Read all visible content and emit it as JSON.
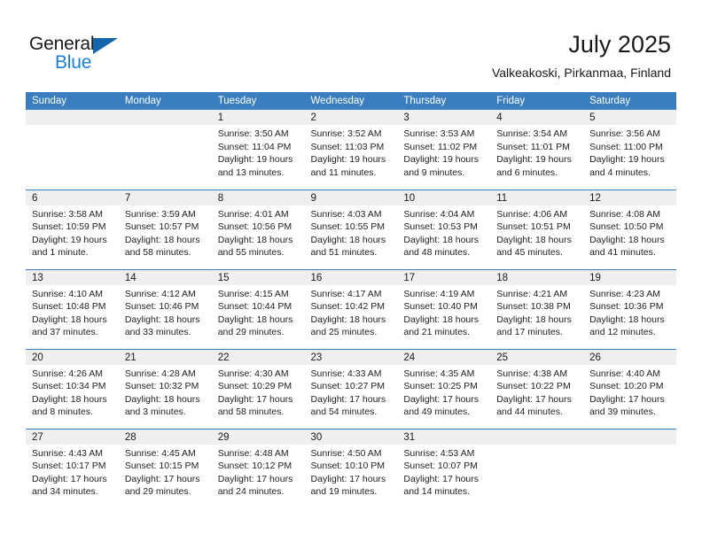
{
  "brand": {
    "name_part1": "General",
    "name_part2": "Blue",
    "triangle_color": "#1565ad",
    "blue_color": "#1a7fd4"
  },
  "header": {
    "title": "July 2025",
    "subtitle": "Valkeakoski, Pirkanmaa, Finland"
  },
  "theme": {
    "header_bg": "#3a7ec0",
    "daynum_bg": "#efefef",
    "text": "#1a1a1a"
  },
  "weekdays": [
    "Sunday",
    "Monday",
    "Tuesday",
    "Wednesday",
    "Thursday",
    "Friday",
    "Saturday"
  ],
  "weeks": [
    [
      {
        "day": ""
      },
      {
        "day": ""
      },
      {
        "day": "1",
        "sunrise": "Sunrise: 3:50 AM",
        "sunset": "Sunset: 11:04 PM",
        "daylight_1": "Daylight: 19 hours",
        "daylight_2": "and 13 minutes."
      },
      {
        "day": "2",
        "sunrise": "Sunrise: 3:52 AM",
        "sunset": "Sunset: 11:03 PM",
        "daylight_1": "Daylight: 19 hours",
        "daylight_2": "and 11 minutes."
      },
      {
        "day": "3",
        "sunrise": "Sunrise: 3:53 AM",
        "sunset": "Sunset: 11:02 PM",
        "daylight_1": "Daylight: 19 hours",
        "daylight_2": "and 9 minutes."
      },
      {
        "day": "4",
        "sunrise": "Sunrise: 3:54 AM",
        "sunset": "Sunset: 11:01 PM",
        "daylight_1": "Daylight: 19 hours",
        "daylight_2": "and 6 minutes."
      },
      {
        "day": "5",
        "sunrise": "Sunrise: 3:56 AM",
        "sunset": "Sunset: 11:00 PM",
        "daylight_1": "Daylight: 19 hours",
        "daylight_2": "and 4 minutes."
      }
    ],
    [
      {
        "day": "6",
        "sunrise": "Sunrise: 3:58 AM",
        "sunset": "Sunset: 10:59 PM",
        "daylight_1": "Daylight: 19 hours",
        "daylight_2": "and 1 minute."
      },
      {
        "day": "7",
        "sunrise": "Sunrise: 3:59 AM",
        "sunset": "Sunset: 10:57 PM",
        "daylight_1": "Daylight: 18 hours",
        "daylight_2": "and 58 minutes."
      },
      {
        "day": "8",
        "sunrise": "Sunrise: 4:01 AM",
        "sunset": "Sunset: 10:56 PM",
        "daylight_1": "Daylight: 18 hours",
        "daylight_2": "and 55 minutes."
      },
      {
        "day": "9",
        "sunrise": "Sunrise: 4:03 AM",
        "sunset": "Sunset: 10:55 PM",
        "daylight_1": "Daylight: 18 hours",
        "daylight_2": "and 51 minutes."
      },
      {
        "day": "10",
        "sunrise": "Sunrise: 4:04 AM",
        "sunset": "Sunset: 10:53 PM",
        "daylight_1": "Daylight: 18 hours",
        "daylight_2": "and 48 minutes."
      },
      {
        "day": "11",
        "sunrise": "Sunrise: 4:06 AM",
        "sunset": "Sunset: 10:51 PM",
        "daylight_1": "Daylight: 18 hours",
        "daylight_2": "and 45 minutes."
      },
      {
        "day": "12",
        "sunrise": "Sunrise: 4:08 AM",
        "sunset": "Sunset: 10:50 PM",
        "daylight_1": "Daylight: 18 hours",
        "daylight_2": "and 41 minutes."
      }
    ],
    [
      {
        "day": "13",
        "sunrise": "Sunrise: 4:10 AM",
        "sunset": "Sunset: 10:48 PM",
        "daylight_1": "Daylight: 18 hours",
        "daylight_2": "and 37 minutes."
      },
      {
        "day": "14",
        "sunrise": "Sunrise: 4:12 AM",
        "sunset": "Sunset: 10:46 PM",
        "daylight_1": "Daylight: 18 hours",
        "daylight_2": "and 33 minutes."
      },
      {
        "day": "15",
        "sunrise": "Sunrise: 4:15 AM",
        "sunset": "Sunset: 10:44 PM",
        "daylight_1": "Daylight: 18 hours",
        "daylight_2": "and 29 minutes."
      },
      {
        "day": "16",
        "sunrise": "Sunrise: 4:17 AM",
        "sunset": "Sunset: 10:42 PM",
        "daylight_1": "Daylight: 18 hours",
        "daylight_2": "and 25 minutes."
      },
      {
        "day": "17",
        "sunrise": "Sunrise: 4:19 AM",
        "sunset": "Sunset: 10:40 PM",
        "daylight_1": "Daylight: 18 hours",
        "daylight_2": "and 21 minutes."
      },
      {
        "day": "18",
        "sunrise": "Sunrise: 4:21 AM",
        "sunset": "Sunset: 10:38 PM",
        "daylight_1": "Daylight: 18 hours",
        "daylight_2": "and 17 minutes."
      },
      {
        "day": "19",
        "sunrise": "Sunrise: 4:23 AM",
        "sunset": "Sunset: 10:36 PM",
        "daylight_1": "Daylight: 18 hours",
        "daylight_2": "and 12 minutes."
      }
    ],
    [
      {
        "day": "20",
        "sunrise": "Sunrise: 4:26 AM",
        "sunset": "Sunset: 10:34 PM",
        "daylight_1": "Daylight: 18 hours",
        "daylight_2": "and 8 minutes."
      },
      {
        "day": "21",
        "sunrise": "Sunrise: 4:28 AM",
        "sunset": "Sunset: 10:32 PM",
        "daylight_1": "Daylight: 18 hours",
        "daylight_2": "and 3 minutes."
      },
      {
        "day": "22",
        "sunrise": "Sunrise: 4:30 AM",
        "sunset": "Sunset: 10:29 PM",
        "daylight_1": "Daylight: 17 hours",
        "daylight_2": "and 58 minutes."
      },
      {
        "day": "23",
        "sunrise": "Sunrise: 4:33 AM",
        "sunset": "Sunset: 10:27 PM",
        "daylight_1": "Daylight: 17 hours",
        "daylight_2": "and 54 minutes."
      },
      {
        "day": "24",
        "sunrise": "Sunrise: 4:35 AM",
        "sunset": "Sunset: 10:25 PM",
        "daylight_1": "Daylight: 17 hours",
        "daylight_2": "and 49 minutes."
      },
      {
        "day": "25",
        "sunrise": "Sunrise: 4:38 AM",
        "sunset": "Sunset: 10:22 PM",
        "daylight_1": "Daylight: 17 hours",
        "daylight_2": "and 44 minutes."
      },
      {
        "day": "26",
        "sunrise": "Sunrise: 4:40 AM",
        "sunset": "Sunset: 10:20 PM",
        "daylight_1": "Daylight: 17 hours",
        "daylight_2": "and 39 minutes."
      }
    ],
    [
      {
        "day": "27",
        "sunrise": "Sunrise: 4:43 AM",
        "sunset": "Sunset: 10:17 PM",
        "daylight_1": "Daylight: 17 hours",
        "daylight_2": "and 34 minutes."
      },
      {
        "day": "28",
        "sunrise": "Sunrise: 4:45 AM",
        "sunset": "Sunset: 10:15 PM",
        "daylight_1": "Daylight: 17 hours",
        "daylight_2": "and 29 minutes."
      },
      {
        "day": "29",
        "sunrise": "Sunrise: 4:48 AM",
        "sunset": "Sunset: 10:12 PM",
        "daylight_1": "Daylight: 17 hours",
        "daylight_2": "and 24 minutes."
      },
      {
        "day": "30",
        "sunrise": "Sunrise: 4:50 AM",
        "sunset": "Sunset: 10:10 PM",
        "daylight_1": "Daylight: 17 hours",
        "daylight_2": "and 19 minutes."
      },
      {
        "day": "31",
        "sunrise": "Sunrise: 4:53 AM",
        "sunset": "Sunset: 10:07 PM",
        "daylight_1": "Daylight: 17 hours",
        "daylight_2": "and 14 minutes."
      },
      {
        "day": ""
      },
      {
        "day": ""
      }
    ]
  ]
}
